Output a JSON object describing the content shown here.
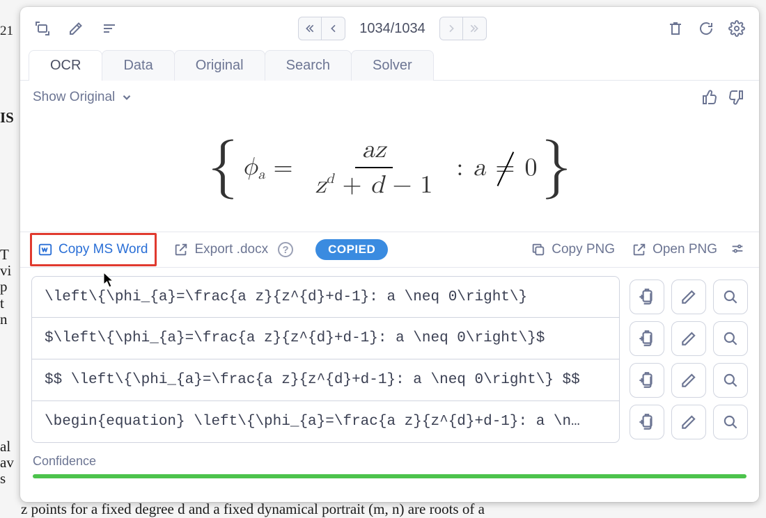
{
  "background_fragments": {
    "top_left": "21",
    "left_col": [
      "IS",
      "",
      "",
      "",
      "T",
      "vi",
      "p",
      "t",
      "n",
      "",
      "",
      "",
      "",
      "",
      "",
      "",
      "",
      "al",
      "av",
      "s"
    ],
    "bottom": "z points for a fixed degree d and a fixed dynamical portrait (m, n) are roots of a"
  },
  "toolbar": {
    "page_counter": "1034/1034"
  },
  "tabs": [
    {
      "id": "ocr",
      "label": "OCR",
      "active": true
    },
    {
      "id": "data",
      "label": "Data",
      "active": false
    },
    {
      "id": "original",
      "label": "Original",
      "active": false
    },
    {
      "id": "search",
      "label": "Search",
      "active": false
    },
    {
      "id": "solver",
      "label": "Solver",
      "active": false
    }
  ],
  "subbar": {
    "show_original": "Show Original"
  },
  "equation": {
    "phi": "ϕ",
    "a": "a",
    "eq": "=",
    "z": "z",
    "d": "d",
    "minus": "−",
    "one": "1",
    "plus": "+",
    "colon": ":",
    "neq_lhs": "a",
    "neq_sym": "=",
    "zero": "0"
  },
  "actions": {
    "copy_ms_word": "Copy MS Word",
    "export_docx": "Export .docx",
    "copied_badge": "COPIED",
    "copy_png": "Copy PNG",
    "open_png": "Open PNG"
  },
  "code_rows": [
    "\\left\\{\\phi_{a}=\\frac{a z}{z^{d}+d-1}: a \\neq 0\\right\\}",
    "$\\left\\{\\phi_{a}=\\frac{a z}{z^{d}+d-1}: a \\neq 0\\right\\}$",
    "$$ \\left\\{\\phi_{a}=\\frac{a z}{z^{d}+d-1}: a \\neq 0\\right\\} $$",
    "\\begin{equation} \\left\\{\\phi_{a}=\\frac{a z}{z^{d}+d-1}: a \\n…"
  ],
  "confidence": {
    "label": "Confidence",
    "percent": 100
  }
}
